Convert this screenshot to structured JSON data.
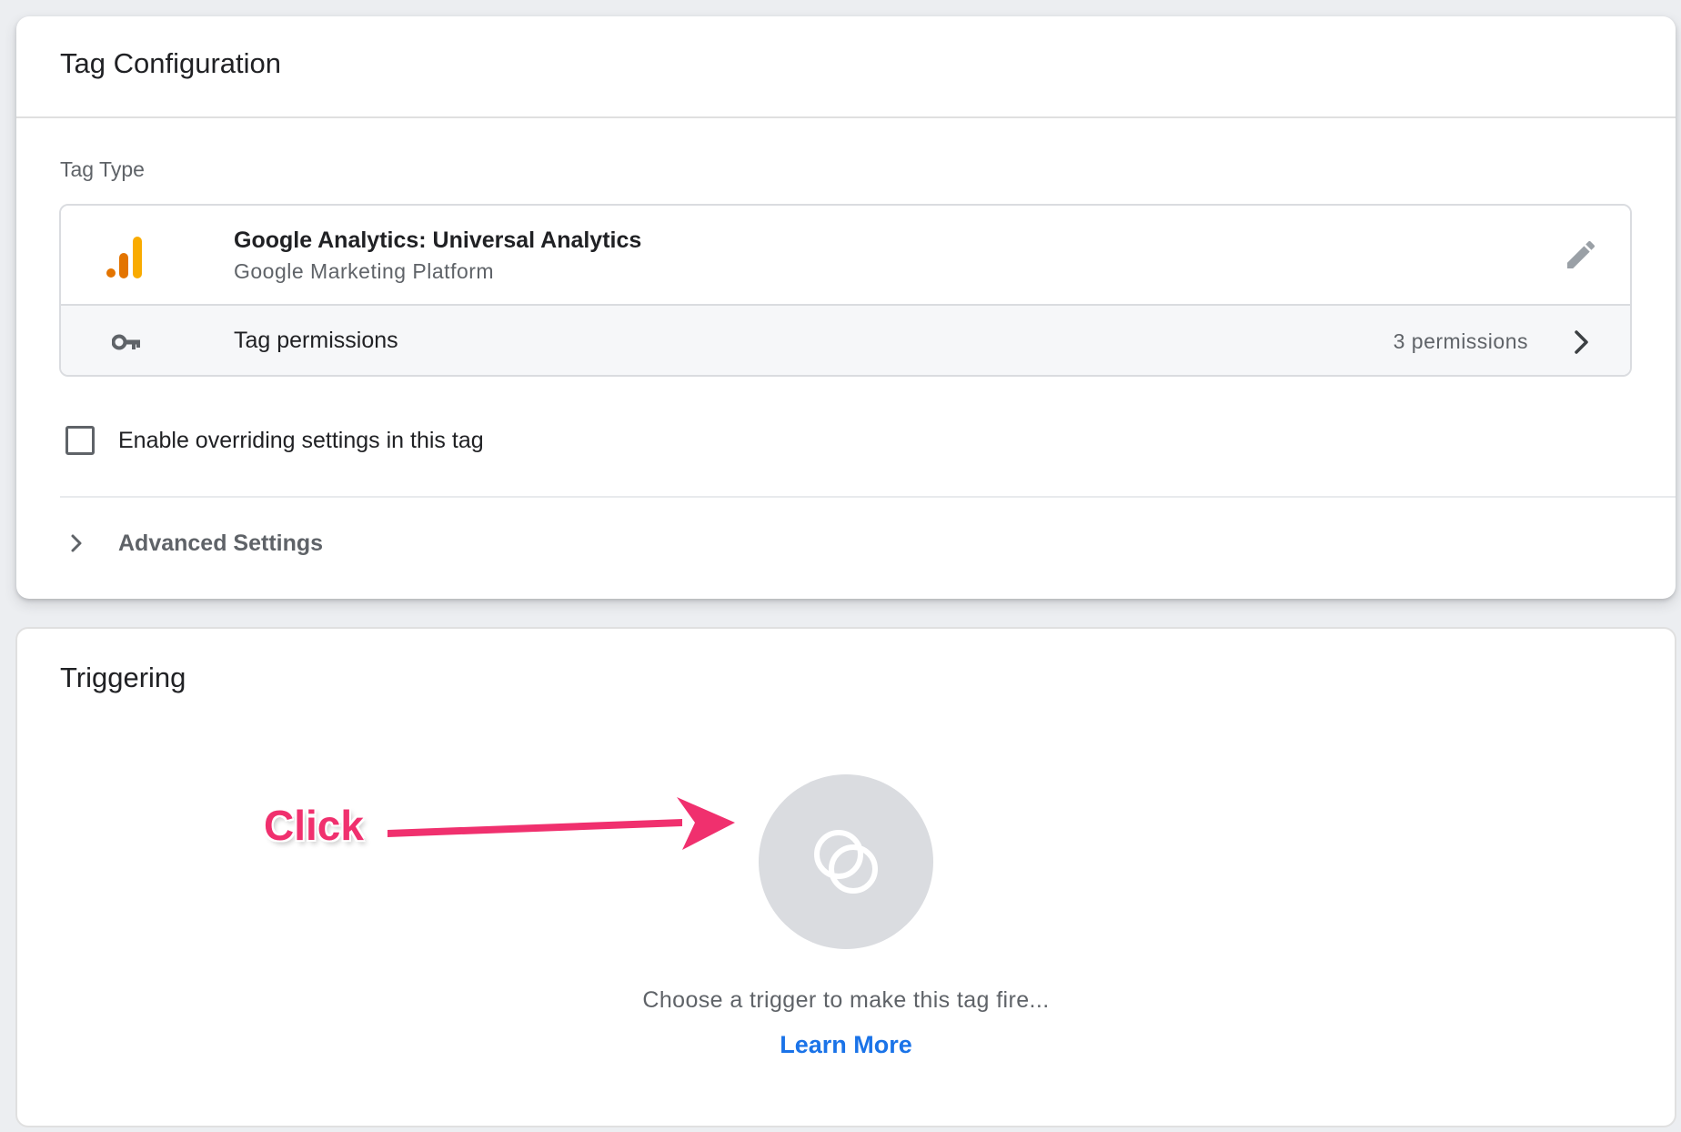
{
  "tag_configuration": {
    "title": "Tag Configuration",
    "tag_type_label": "Tag Type",
    "tag_type": {
      "name": "Google Analytics: Universal Analytics",
      "vendor": "Google Marketing Platform",
      "icon": "google-analytics-icon"
    },
    "permissions": {
      "label": "Tag permissions",
      "count": "3 permissions",
      "icon": "key-icon"
    },
    "override_checkbox": {
      "label": "Enable overriding settings in this tag",
      "checked": false
    },
    "advanced_settings": {
      "label": "Advanced Settings",
      "icon": "chevron-right-icon"
    }
  },
  "triggering": {
    "title": "Triggering",
    "hint": "Choose a trigger to make this tag fire...",
    "learn_more": "Learn More",
    "icon": "trigger-icon"
  },
  "annotation": {
    "label": "Click",
    "color": "#f0306e"
  },
  "colors": {
    "background": "#eceef1",
    "link": "#1a73e8",
    "ga_orange": "#e37400",
    "ga_yellow": "#f9ab00"
  }
}
